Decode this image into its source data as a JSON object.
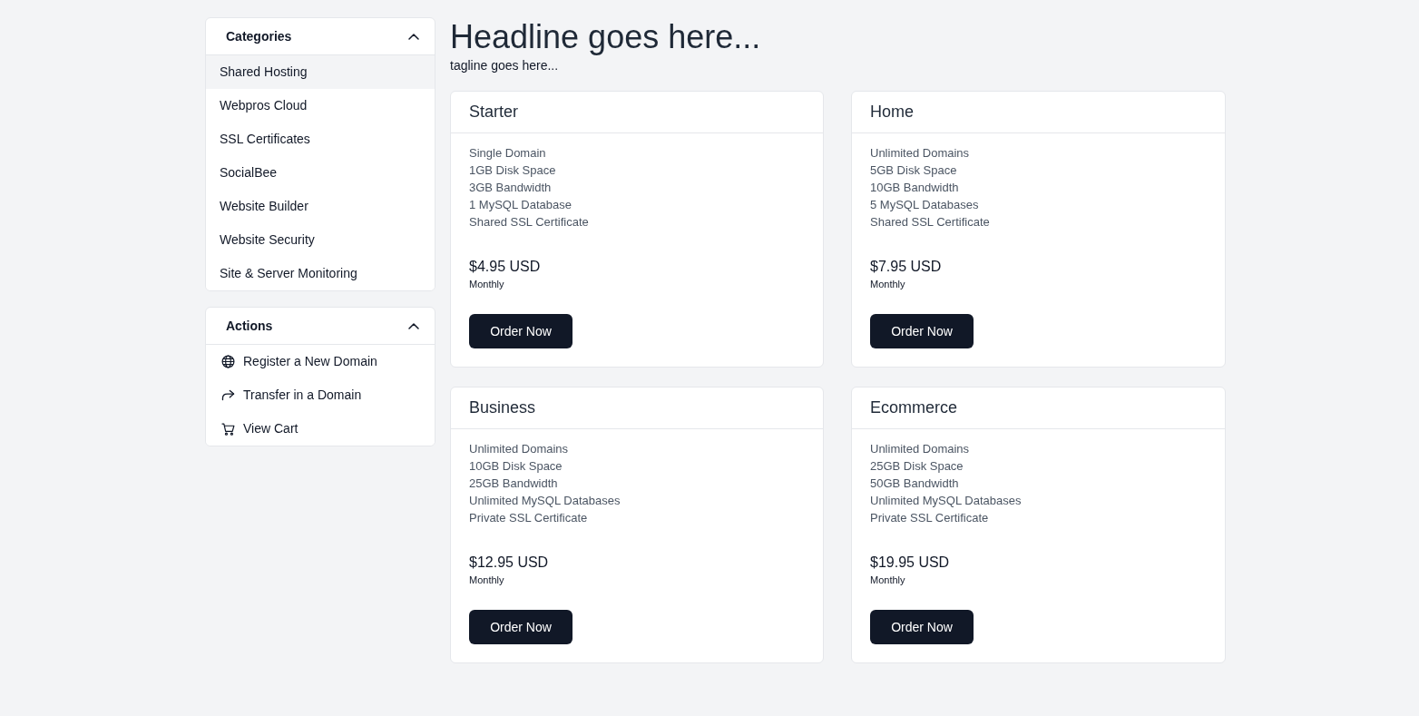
{
  "sidebar": {
    "panels": [
      {
        "title": "Categories",
        "expanded": true,
        "items": [
          {
            "label": "Shared Hosting",
            "selected": true
          },
          {
            "label": "Webpros Cloud",
            "selected": false
          },
          {
            "label": "SSL Certificates",
            "selected": false
          },
          {
            "label": "SocialBee",
            "selected": false
          },
          {
            "label": "Website Builder",
            "selected": false
          },
          {
            "label": "Website Security",
            "selected": false
          },
          {
            "label": "Site & Server Monitoring",
            "selected": false
          }
        ]
      },
      {
        "title": "Actions",
        "expanded": true,
        "items": [
          {
            "label": "Register a New Domain"
          },
          {
            "label": "Transfer in a Domain"
          },
          {
            "label": "View Cart"
          }
        ]
      }
    ]
  },
  "header": {
    "headline": "Headline goes here...",
    "tagline": "tagline goes here..."
  },
  "products": [
    {
      "name": "Starter",
      "features": [
        "Single Domain",
        "1GB Disk Space",
        "3GB Bandwidth",
        "1 MySQL Database",
        "Shared SSL Certificate"
      ],
      "price": "$4.95 USD",
      "cycle": "Monthly",
      "button": "Order Now"
    },
    {
      "name": "Home",
      "features": [
        "Unlimited Domains",
        "5GB Disk Space",
        "10GB Bandwidth",
        "5 MySQL Databases",
        "Shared SSL Certificate"
      ],
      "price": "$7.95 USD",
      "cycle": "Monthly",
      "button": "Order Now"
    },
    {
      "name": "Business",
      "features": [
        "Unlimited Domains",
        "10GB Disk Space",
        "25GB Bandwidth",
        "Unlimited MySQL Databases",
        "Private SSL Certificate"
      ],
      "price": "$12.95 USD",
      "cycle": "Monthly",
      "button": "Order Now"
    },
    {
      "name": "Ecommerce",
      "features": [
        "Unlimited Domains",
        "25GB Disk Space",
        "50GB Bandwidth",
        "Unlimited MySQL Databases",
        "Private SSL Certificate"
      ],
      "price": "$19.95 USD",
      "cycle": "Monthly",
      "button": "Order Now"
    }
  ]
}
